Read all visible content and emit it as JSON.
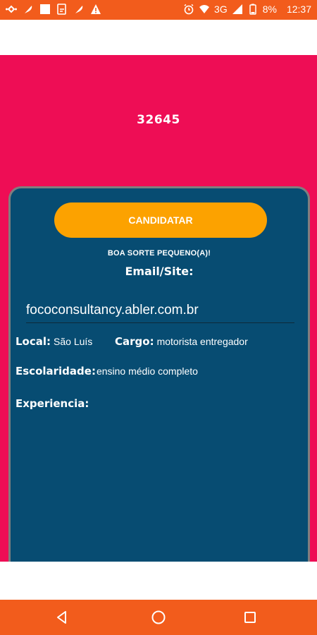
{
  "status_bar": {
    "network": "3G",
    "battery": "8%",
    "time": "12:37"
  },
  "job": {
    "number": "32645"
  },
  "card": {
    "apply_label": "CANDIDATAR",
    "good_luck": "BOA SORTE PEQUENO(A)!",
    "email_label": "Email/Site:",
    "email_value": "fococonsultancy.abler.com.br",
    "local_label": "Local:",
    "local_value": "São Luís",
    "cargo_label": "Cargo:",
    "cargo_value": "motorista entregador",
    "escolaridade_label": "Escolaridade:",
    "escolaridade_value": "ensino médio completo",
    "experiencia_label": "Experiencia:",
    "experiencia_value": ""
  },
  "colors": {
    "status_bar": "#f25c1c",
    "header": "#ee0d55",
    "card": "#074c72",
    "button": "#fca200"
  },
  "nav": {
    "icons": [
      "back-icon",
      "home-icon",
      "recents-icon"
    ]
  }
}
